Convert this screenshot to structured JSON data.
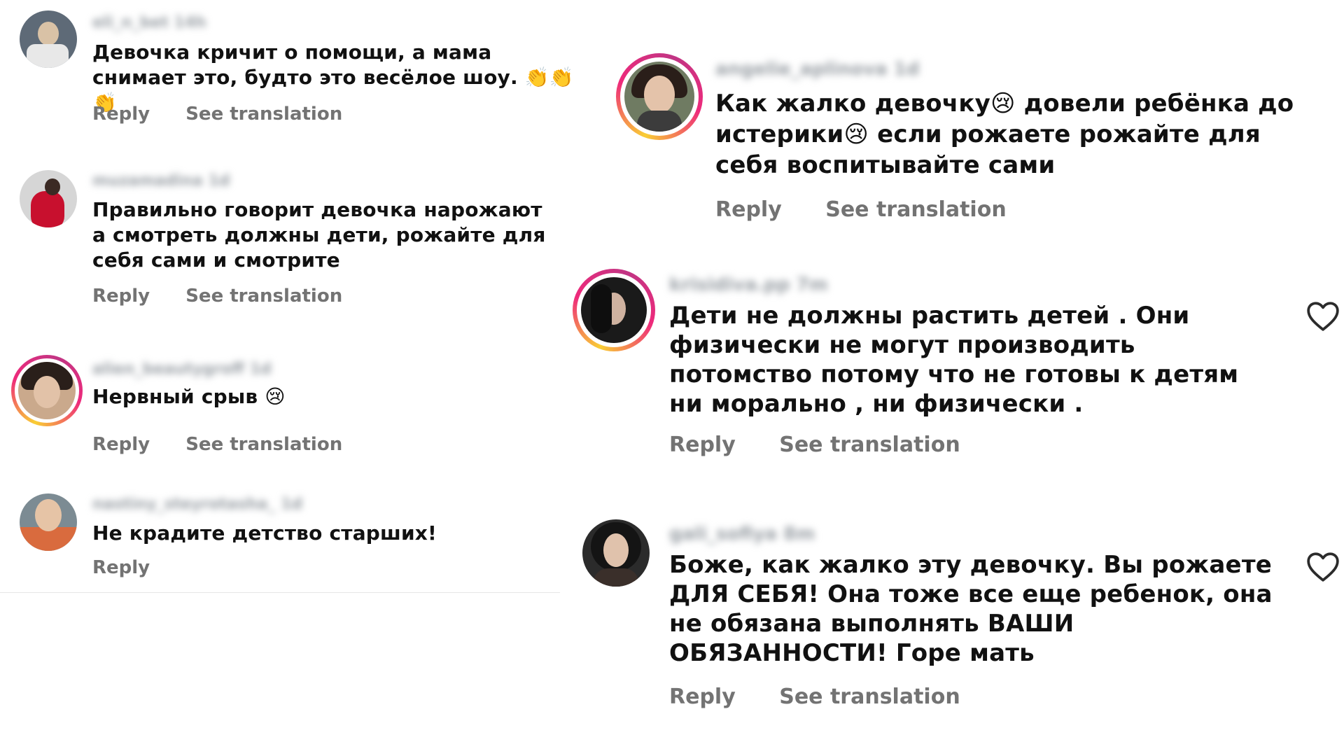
{
  "left_comments": [
    {
      "username": "eli_n_bet 14h",
      "text": "Девочка кричит о помощи, а мама снимает это, будто это весёлое шоу. 👏👏👏",
      "reply": "Reply",
      "translate": "See translation"
    },
    {
      "username": "muzamadina 1d",
      "text": "Правильно говорит девочка нарожают а смотреть должны дети, рожайте для себя сами и смотрите",
      "reply": "Reply",
      "translate": "See translation"
    },
    {
      "username": "alien_beautygroff 1d",
      "text": "Нервный срыв 😢",
      "reply": "Reply",
      "translate": "See translation"
    },
    {
      "username": "nastiny_steyrotasha_ 1d",
      "text": "Не крадите детство старших!",
      "reply": "Reply"
    }
  ],
  "right_comments": [
    {
      "username": "angelie_aplinova 1d",
      "text": "Как жалко девочку😢 довели ребёнка до истерики😢 если рожаете рожайте для себя воспитывайте сами",
      "reply": "Reply",
      "translate": "See translation"
    },
    {
      "username": "krisidiva.pp 7m",
      "text": "Дети не должны растить детей . Они физически не могут производить потомство потому что не готовы к детям ни морально , ни физически .",
      "reply": "Reply",
      "translate": "See translation"
    },
    {
      "username": "gali_sofiya 8m",
      "text": "Боже, как жалко эту девочку. Вы рожаете ДЛЯ СЕБЯ! Она тоже все еще ребенок, она не обязана выполнять ВАШИ ОБЯЗАННОСТИ! Горе мать",
      "reply": "Reply",
      "translate": "See translation"
    }
  ],
  "icons": {
    "heart": "heart-outline-icon"
  },
  "colors": {
    "text": "#111111",
    "secondary": "#737373",
    "story_ring_start": "#f9ce34",
    "story_ring_end": "#c13584"
  }
}
